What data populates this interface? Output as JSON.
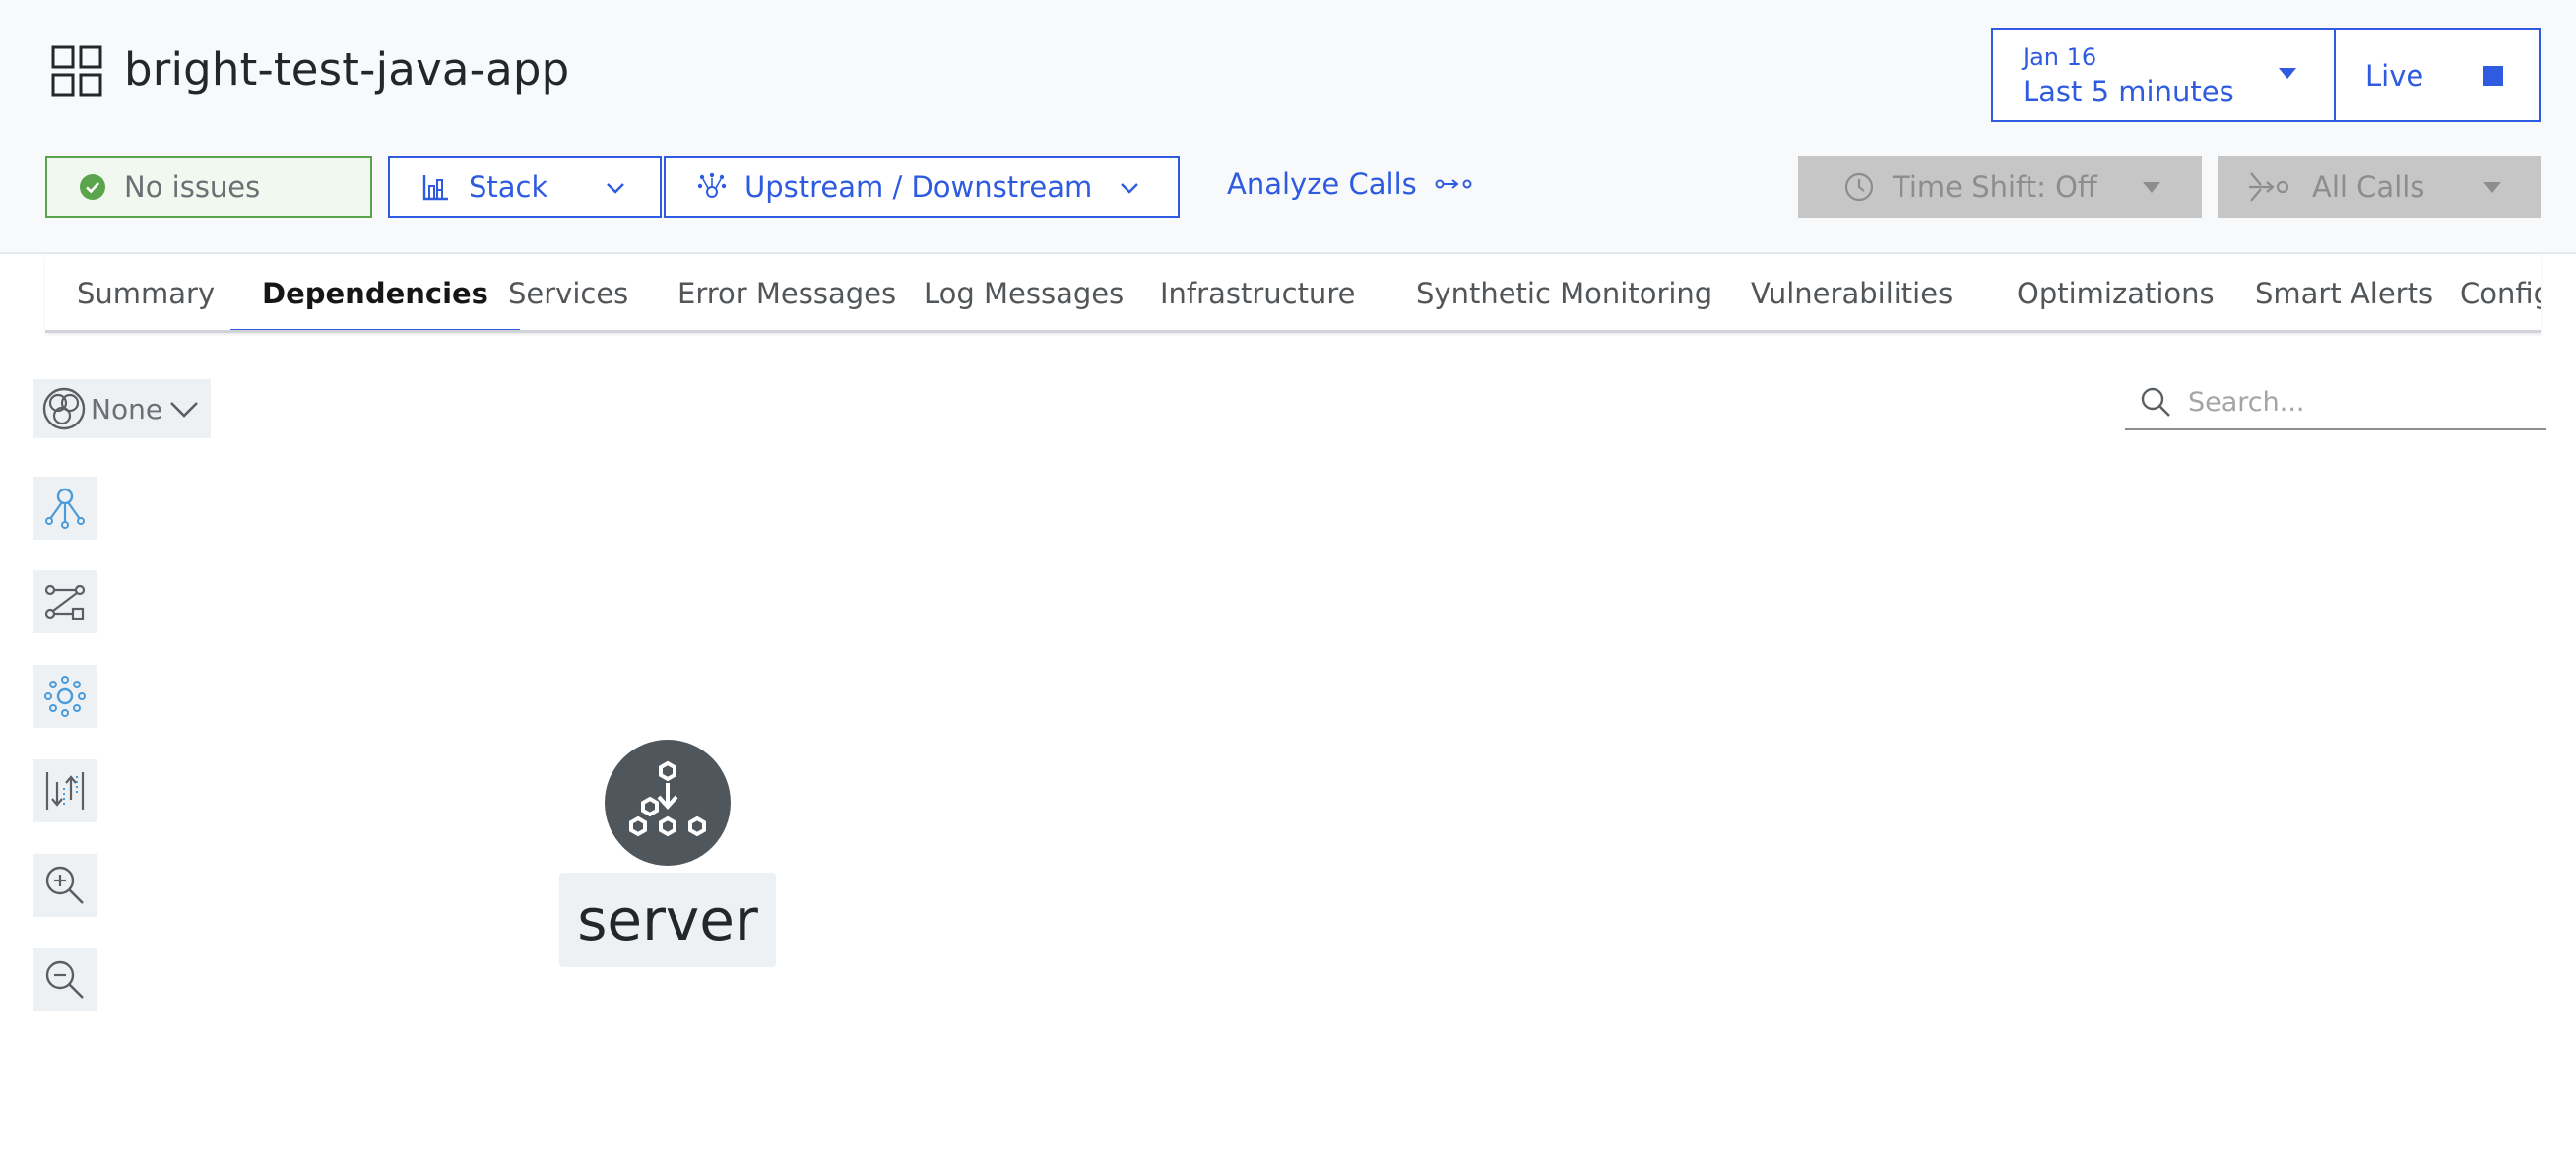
{
  "header": {
    "app_title": "bright-test-java-app",
    "app_icon": "application-icon"
  },
  "timepicker": {
    "date": "Jan 16",
    "window": "Last 5 minutes",
    "live_label": "Live"
  },
  "toolbar": {
    "issues_label": "No issues",
    "stack_label": "Stack",
    "upstream_label": "Upstream / Downstream",
    "analyze_label": "Analyze Calls",
    "time_shift_label": "Time Shift: Off",
    "all_calls_label": "All Calls"
  },
  "tabs": [
    {
      "label": "Summary",
      "active": false
    },
    {
      "label": "Dependencies",
      "active": true
    },
    {
      "label": "Services",
      "active": false
    },
    {
      "label": "Error Messages",
      "active": false
    },
    {
      "label": "Log Messages",
      "active": false
    },
    {
      "label": "Infrastructure",
      "active": false
    },
    {
      "label": "Synthetic Monitoring",
      "active": false
    },
    {
      "label": "Vulnerabilities",
      "active": false
    },
    {
      "label": "Optimizations",
      "active": false
    },
    {
      "label": "Smart Alerts",
      "active": false
    },
    {
      "label": "Configu",
      "active": false
    }
  ],
  "canvas": {
    "group_by_label": "None",
    "search_placeholder": "Search...",
    "tools": [
      "hierarchy-layout-icon",
      "path-layout-icon",
      "radial-layout-icon",
      "sort-icon",
      "zoom-in-icon",
      "zoom-out-icon"
    ],
    "node": {
      "label": "server",
      "icon": "service-hexagons-icon"
    }
  },
  "colors": {
    "accent": "#2f5be0",
    "success": "#5aa44c",
    "node_fill": "#4f565c",
    "tool_icon_blue": "#4a9bd9"
  }
}
